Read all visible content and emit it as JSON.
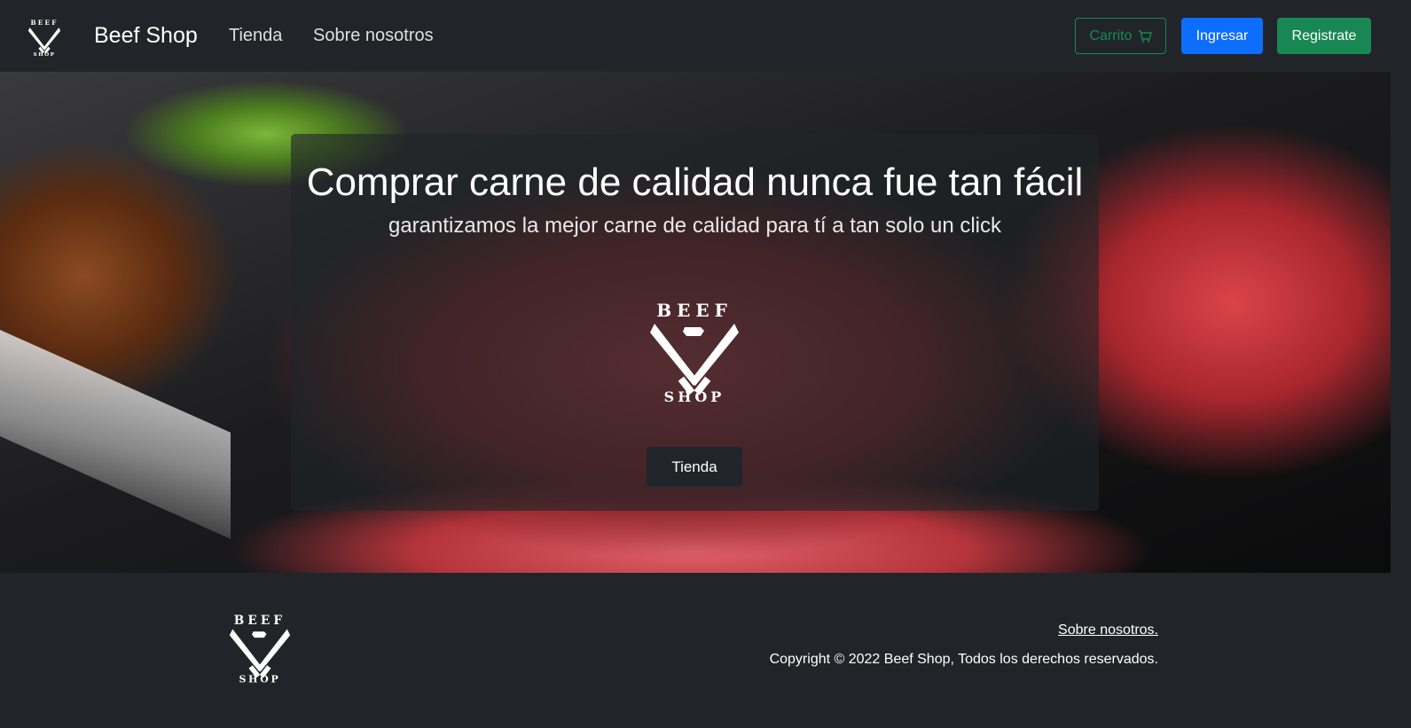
{
  "navbar": {
    "brand": "Beef Shop",
    "links": [
      "Tienda",
      "Sobre nosotros"
    ],
    "cart_label": "Carrito",
    "cart_icon": "cart-icon",
    "login_label": "Ingresar",
    "register_label": "Registrate"
  },
  "logo": {
    "top_text": "BEEF",
    "bottom_text": "SHOP"
  },
  "hero": {
    "title": "Comprar carne de calidad nunca fue tan fácil",
    "subtitle": "garantizamos la mejor carne de calidad para tí a tan solo un click",
    "button_label": "Tienda"
  },
  "footer": {
    "link_label": "Sobre nosotros.",
    "copyright": "Copyright © 2022 Beef Shop, Todos los derechos reservados."
  },
  "colors": {
    "dark": "#212529",
    "primary": "#0d6efd",
    "success": "#198754"
  }
}
